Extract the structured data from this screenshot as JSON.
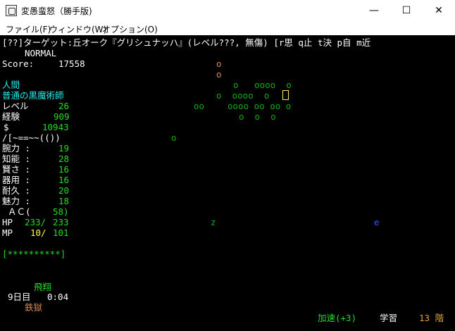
{
  "window": {
    "title": "変愚蛮怒（勝手版)",
    "minimize": "—",
    "maximize": "☐",
    "close": "✕"
  },
  "menu": {
    "file": "ファイル(F)",
    "window": "ウィンドウ(W)",
    "options": "オプション(O)"
  },
  "status": {
    "target_line": "[??]ターゲット:丘オーク『グリシュナッハ』(レベル???, 無傷) [r思 q止 t決 p自 m近",
    "mode": "NORMAL",
    "score_label": "Score:",
    "score": "17558"
  },
  "character": {
    "race": "人間",
    "class": "普通の黒魔術師",
    "level_label": "レベル",
    "level": "26",
    "exp_label": "経験",
    "exp": "909",
    "gold_label": "$",
    "gold": "10943",
    "equip_row": "/[~==~~(())",
    "stats": [
      {
        "label": "腕力 :",
        "value": "19"
      },
      {
        "label": "知能 :",
        "value": "28"
      },
      {
        "label": "賢さ :",
        "value": "16"
      },
      {
        "label": "器用 :",
        "value": "16"
      },
      {
        "label": "耐久 :",
        "value": "20"
      },
      {
        "label": "魅力 :",
        "value": "18"
      }
    ],
    "ac_label": "ＡＣ(",
    "ac": "58)",
    "hp_label": "HP",
    "hp_cur": "233/",
    "hp_max": "233",
    "mp_label": "MP",
    "mp_cur": "10/",
    "mp_max": "101",
    "health_bar": "[**********]",
    "flying": "飛翔",
    "day": "9日目",
    "time": "0:04",
    "location": "鉄獄"
  },
  "bottom": {
    "speed": "加速(+3)",
    "learn": "学習",
    "depth": "13 階"
  },
  "map": {
    "row1": "o",
    "row2": "o",
    "row3": "o   oooo  o",
    "row4a": "o  oooo  o",
    "row5a": "oo",
    "row5b": "oooo oo oo o",
    "row6": "o  o  o",
    "row7": "o",
    "z": "z",
    "e": "e"
  }
}
